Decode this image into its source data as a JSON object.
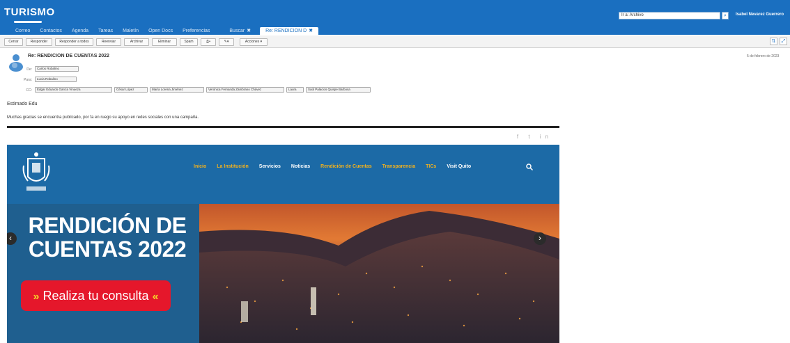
{
  "app": {
    "logo": "TURISMO",
    "search_value": "Ir a: Archivo",
    "user_name": "Isabel Nevarez Guerrero"
  },
  "tabs": [
    "Correo",
    "Contactos",
    "Agenda",
    "Tareas",
    "Maletín",
    "Open Docs",
    "Preferencias"
  ],
  "tab_search": "Buscar",
  "tab_active": "Re: RENDICION D",
  "toolbar": [
    "Cerrar",
    "Responder",
    "Responder a todos",
    "Reenviar",
    "Archivar",
    "Eliminar",
    "Spam",
    "",
    "",
    "Acciones"
  ],
  "message": {
    "subject": "Re: RENDICION DE CUENTAS 2022",
    "date": "5 de febrero de 2023",
    "labels": {
      "from": "De:",
      "to": "Para:",
      "cc": "CC:"
    },
    "from_chips": [
      "Carlos Robalino"
    ],
    "to_chips": [
      "Lucia Robalino"
    ],
    "cc_chips": [
      "Edgar Eduardo García Vinueza",
      "César López",
      "María Lorena Jiménez",
      "Verónica Fernanda Zambrano Chávez",
      "Laura",
      "Saúl Palacios Quispe Barbosa"
    ],
    "greeting": "Estimado Edu",
    "body": "Muchas gracias se encuentra publicado, por fa en ruego su apoyo en redes sociales con una campaña."
  },
  "website": {
    "social": "f  t  in",
    "menu": [
      "Inicio",
      "La Institución",
      "Servicios",
      "Noticias",
      "Rendición de Cuentas",
      "Transparencia",
      "TICs",
      "Visit Quito"
    ],
    "hero_title": "RENDICIÓN DE CUENTAS 2022",
    "hero_button": "Realiza tu consulta",
    "prev": "‹",
    "next": "›"
  },
  "colors": {
    "header_blue": "#1a6fc0",
    "site_blue": "#1c6aa6",
    "button_red": "#e5172b",
    "menu_highlight": "#f2b11e"
  }
}
